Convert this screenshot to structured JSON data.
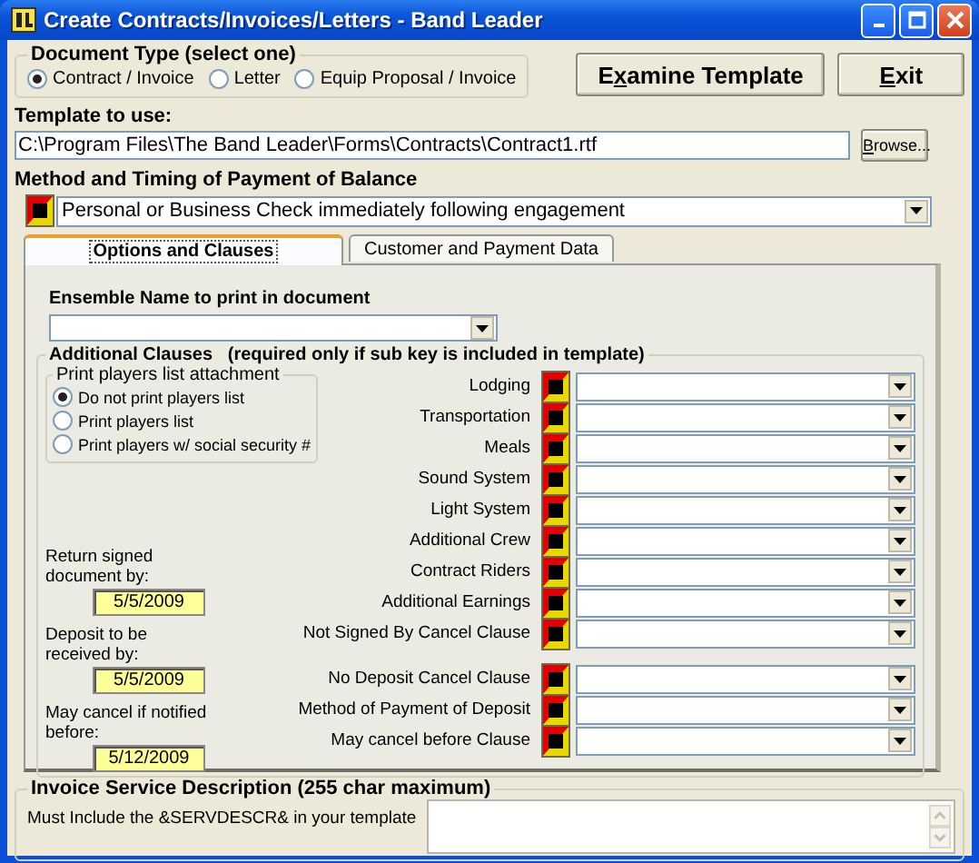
{
  "window": {
    "title": "Create Contracts/Invoices/Letters - Band Leader"
  },
  "document_type": {
    "label": "Document Type (select one)",
    "options": [
      {
        "label": "Contract / Invoice",
        "selected": true
      },
      {
        "label": "Letter",
        "selected": false
      },
      {
        "label": "Equip Proposal / Invoice",
        "selected": false
      }
    ]
  },
  "buttons": [
    {
      "label": "Examine Template"
    },
    {
      "label": "Exit"
    }
  ],
  "template": {
    "label": "Template to use:",
    "value": "C:\\Program Files\\The Band Leader\\Forms\\Contracts\\Contract1.rtf",
    "browse": {
      "label": "Browse..."
    }
  },
  "payment_method": {
    "label": "Method and Timing of Payment of Balance",
    "value": "Personal or Business Check immediately following engagement"
  },
  "tabs": [
    {
      "label": "Options and Clauses",
      "selected": true
    },
    {
      "label": "Customer and Payment Data",
      "selected": false
    }
  ],
  "ensemble": {
    "label": "Ensemble Name to print in document"
  },
  "additional_clauses": {
    "label": "Additional Clauses",
    "note": "(required only if sub key is included in template)",
    "players_list": {
      "label": "Print players list attachment",
      "options": [
        {
          "label": "Do not print players list",
          "selected": true
        },
        {
          "label": "Print players list",
          "selected": false
        },
        {
          "label": "Print players w/ social security #",
          "selected": false
        }
      ]
    },
    "clauses": [
      {
        "label": "Lodging"
      },
      {
        "label": "Transportation"
      },
      {
        "label": "Meals"
      },
      {
        "label": "Sound System"
      },
      {
        "label": "Light System"
      },
      {
        "label": "Additional Crew"
      },
      {
        "label": "Contract Riders"
      },
      {
        "label": "Additional Earnings"
      },
      {
        "label": "Not Signed By Cancel Clause"
      }
    ],
    "deposit_clauses": [
      {
        "label": "No Deposit Cancel Clause"
      },
      {
        "label": "Method of Payment of Deposit"
      },
      {
        "label": "May cancel before Clause"
      }
    ],
    "dates": [
      {
        "label": "Return signed document by:",
        "value": "5/5/2009"
      },
      {
        "label": "Deposit to be received by:",
        "value": "5/5/2009"
      },
      {
        "label": "May cancel if notified before:",
        "value": "5/12/2009"
      }
    ]
  },
  "invoice_description": {
    "label": "Invoice Service Description (255 char maximum)",
    "hint": "Must Include the &SERVDESCR& in your template"
  }
}
